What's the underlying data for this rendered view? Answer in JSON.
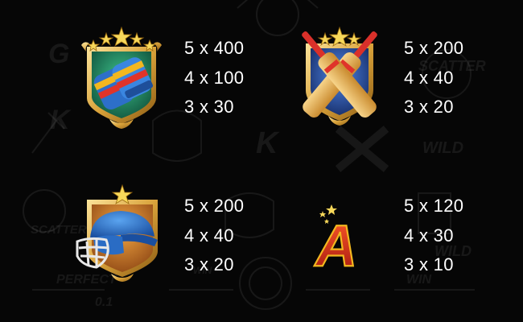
{
  "paytable": {
    "symbols": [
      {
        "id": "gloves",
        "icon": "batting-gloves-icon",
        "stars": 5,
        "payouts": [
          "5 x 400",
          "4 x 100",
          "3 x 30"
        ]
      },
      {
        "id": "bats",
        "icon": "crossed-bats-icon",
        "stars": 3,
        "payouts": [
          "5 x 200",
          "4 x 40",
          "3 x 20"
        ]
      },
      {
        "id": "helmet",
        "icon": "cricket-helmet-icon",
        "stars": 1,
        "payouts": [
          "5 x 200",
          "4 x 40",
          "3 x 20"
        ]
      },
      {
        "id": "letter-a",
        "icon": "letter-a-icon",
        "letter": "A",
        "payouts": [
          "5 x 120",
          "4 x 30",
          "3 x 10"
        ]
      }
    ]
  },
  "background": {
    "faded_labels": [
      "SCATTER",
      "WILD",
      "WILD",
      "SCATTER",
      "PERFECT",
      "0.1",
      "WIN",
      "WIN"
    ]
  },
  "colors": {
    "background": "#060606",
    "text": "#ffffff",
    "gold": "#e8b84a",
    "gloves_shield": "#1a7a5a",
    "bats_shield": "#1d3f8e",
    "helmet_shield": "#c8731f",
    "letter_red": "#d42a1a"
  }
}
